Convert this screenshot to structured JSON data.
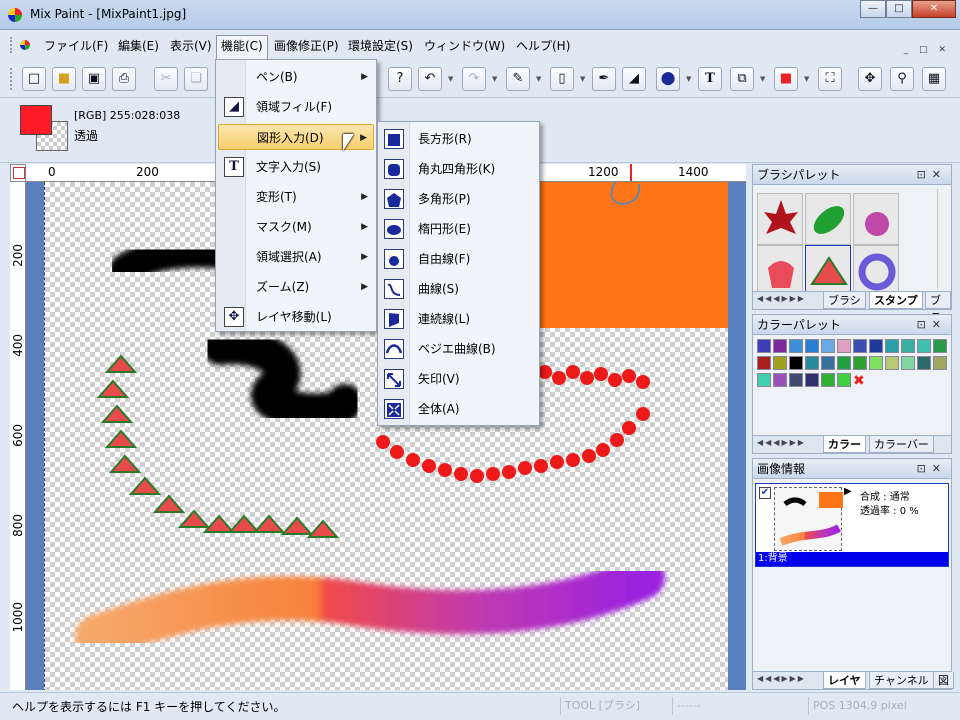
{
  "window": {
    "title": "Mix Paint - [MixPaint1.jpg]"
  },
  "menubar": {
    "items": [
      "ファイル(F)",
      "編集(E)",
      "表示(V)",
      "機能(C)",
      "画像修正(P)",
      "環境設定(S)",
      "ウィンドウ(W)",
      "ヘルプ(H)"
    ],
    "active": "機能(C)"
  },
  "colorbar": {
    "rgb": "[RGB] 255:028:038",
    "bg_label": "透過",
    "fg_color": "#ff1c26"
  },
  "rulers": {
    "top": [
      "0",
      "200",
      "1200",
      "1400"
    ],
    "left": [
      "200",
      "400",
      "600",
      "800",
      "1000"
    ]
  },
  "function_menu": {
    "items": [
      {
        "label": "ペン(B)",
        "submenu": true,
        "icon": ""
      },
      {
        "label": "領域フィル(F)",
        "submenu": false,
        "icon": "fill-bucket-icon"
      },
      {
        "label": "図形入力(D)",
        "submenu": true,
        "icon": "",
        "highlighted": true
      },
      {
        "label": "文字入力(S)",
        "submenu": false,
        "icon": "text-tool-icon"
      },
      {
        "label": "変形(T)",
        "submenu": true,
        "icon": ""
      },
      {
        "label": "マスク(M)",
        "submenu": true,
        "icon": ""
      },
      {
        "label": "領域選択(A)",
        "submenu": true,
        "icon": ""
      },
      {
        "label": "ズーム(Z)",
        "submenu": true,
        "icon": ""
      },
      {
        "label": "レイヤ移動(L)",
        "submenu": false,
        "icon": "move-layer-icon"
      }
    ]
  },
  "shape_submenu": {
    "items": [
      {
        "label": "長方形(R)",
        "icon": "rectangle-icon"
      },
      {
        "label": "角丸四角形(K)",
        "icon": "rounded-rect-icon"
      },
      {
        "label": "多角形(P)",
        "icon": "polygon-icon"
      },
      {
        "label": "楕円形(E)",
        "icon": "ellipse-icon"
      },
      {
        "label": "自由線(F)",
        "icon": "freehand-icon"
      },
      {
        "label": "曲線(S)",
        "icon": "curve-icon"
      },
      {
        "label": "連続線(L)",
        "icon": "polyline-icon"
      },
      {
        "label": "ベジエ曲線(B)",
        "icon": "bezier-icon"
      },
      {
        "label": "矢印(V)",
        "icon": "arrow-icon"
      },
      {
        "label": "全体(A)",
        "icon": "whole-icon"
      }
    ]
  },
  "brush_palette": {
    "title": "ブラシパレット",
    "tabs": [
      "ブラシ",
      "スタンプ",
      "ブラ"
    ],
    "active_tab": "スタンプ"
  },
  "color_palette": {
    "title": "カラーパレット",
    "tabs": [
      "カラー",
      "カラーバー"
    ],
    "active_tab": "カラー",
    "colors": [
      "#3d3db8",
      "#7f2a9a",
      "#3f8fd8",
      "#2b7fd0",
      "#6aa8e6",
      "#e0a0c0",
      "#3c4fb0",
      "#223a9a",
      "#2aa0a8",
      "#3ab0a0",
      "#40c0b0",
      "#2a9a4a",
      "#a8201a",
      "#a0a020",
      "#000000",
      "#2a8a9a",
      "#3a70a0",
      "#20a040",
      "#30a030",
      "#80e060",
      "#b8c878",
      "#80d8a0",
      "#2a6a6a",
      "#a0a860",
      "#40d0b0",
      "#9a50b8",
      "#404a70",
      "#303070",
      "#30b030",
      "#40d040"
    ]
  },
  "image_info": {
    "title": "画像情報",
    "blend": "合成 : 通常",
    "opacity": "透過率 : 0 %",
    "layer_name": "1:背景",
    "tabs": [
      "レイヤ",
      "チャンネル",
      "図"
    ],
    "active_tab": "レイヤ"
  },
  "status": {
    "help": "ヘルプを表示するには F1 キーを押してください。",
    "tool": "TOOL [ブラシ]",
    "blank": "------",
    "pos": "POS 1304,9 pixel"
  }
}
